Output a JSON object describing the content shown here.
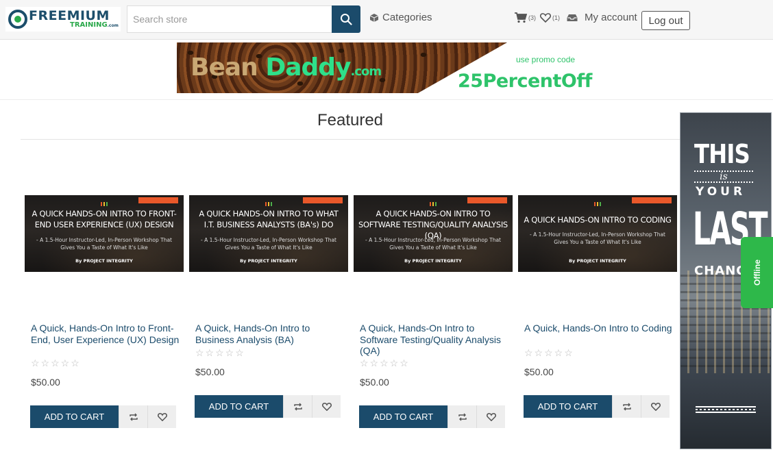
{
  "header": {
    "logo": {
      "main": "FREEMIUM",
      "sub": "TRAINING",
      "suffix": ".com"
    },
    "search": {
      "placeholder": "Search store"
    },
    "categories_label": "Categories",
    "cart_count": "(3)",
    "wishlist_count": "(1)",
    "my_account_label": "My account",
    "logout_label": "Log out"
  },
  "banner": {
    "brand_part1": "Bean ",
    "brand_part2": "Daddy",
    "brand_suffix": ".com",
    "promo_label": "use promo code",
    "promo_code": "25PercentOff"
  },
  "featured": {
    "title": "Featured",
    "products": [
      {
        "thumb_title": "A QUICK HANDS-ON INTRO TO FRONT-END USER EXPERIENCE (UX) DESIGN",
        "thumb_sub": "- A 1.5-Hour Instructor-Led, In-Person Workshop That Gives You a Taste of What It's Like",
        "thumb_by": "By PROJECT INTEGRITY",
        "name": "A Quick, Hands-On Intro to Front-End, User Experience (UX) Design",
        "stars": "☆☆☆☆☆",
        "price": "$50.00",
        "add_to_cart": "ADD TO CART"
      },
      {
        "thumb_title": "A QUICK HANDS-ON INTRO TO WHAT I.T. BUSINESS ANALYSTS (BA's) DO",
        "thumb_sub": "- A 1.5-Hour Instructor-Led, In-Person Workshop That Gives You a Taste of What It's Like",
        "thumb_by": "By PROJECT INTEGRITY",
        "name": "A Quick, Hands-On Intro to Business Analysis (BA)",
        "stars": "☆☆☆☆☆",
        "price": "$50.00",
        "add_to_cart": "ADD TO CART"
      },
      {
        "thumb_title": "A QUICK HANDS-ON INTRO TO SOFTWARE TESTING/QUALITY ANALYSIS (QA)",
        "thumb_sub": "- A 1.5-Hour Instructor-Led, In-Person Workshop That Gives You a Taste of What It's Like",
        "thumb_by": "By PROJECT INTEGRITY",
        "name": "A Quick, Hands-On Intro to Software Testing/Quality Analysis (QA)",
        "stars": "☆☆☆☆☆",
        "price": "$50.00",
        "add_to_cart": "ADD TO CART"
      },
      {
        "thumb_title": "A QUICK HANDS-ON INTRO TO CODING",
        "thumb_sub": "- A 1.5-Hour Instructor-Led, In-Person Workshop That Gives You a Taste of What It's Like",
        "thumb_by": "By PROJECT INTEGRITY",
        "name": "A Quick, Hands-On Intro to Coding",
        "stars": "☆☆☆☆☆",
        "price": "$50.00",
        "add_to_cart": "ADD TO CART"
      }
    ]
  },
  "side_ad": {
    "line1": "THIS",
    "line2": "is",
    "line3": "YOUR",
    "line4": "LAST",
    "line5": "CHANC"
  },
  "chat_tab": {
    "label": "Offline"
  },
  "colors": {
    "primary": "#1b4b6b",
    "accent_green": "#2eb84a"
  }
}
